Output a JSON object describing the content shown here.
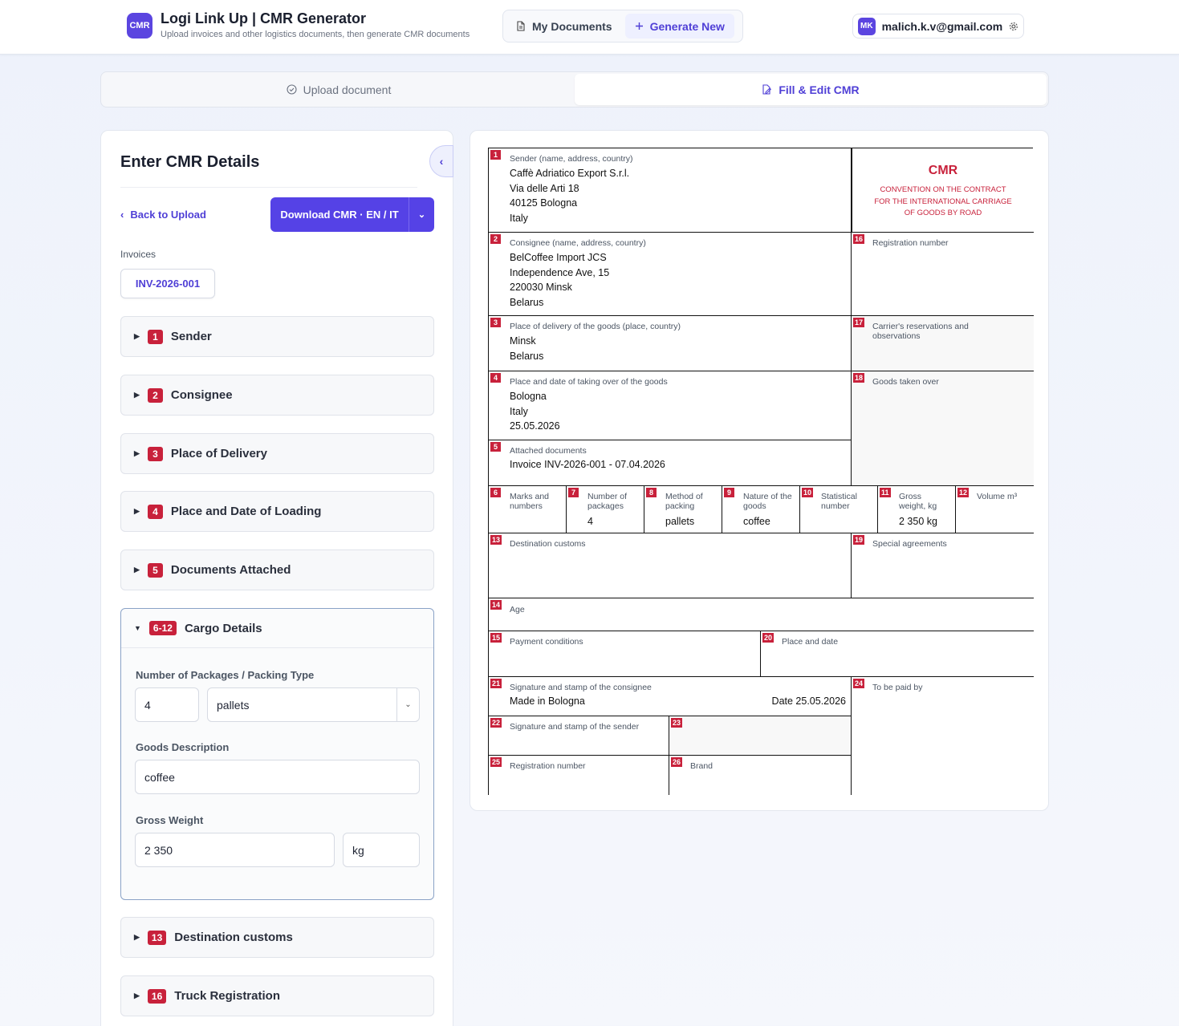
{
  "header": {
    "logo": "CMR",
    "title": "Logi Link Up | CMR Generator",
    "subtitle": "Upload invoices and other logistics documents, then generate CMR documents",
    "nav": [
      {
        "label": "My Documents",
        "icon": "document-icon"
      },
      {
        "label": "Generate New",
        "icon": "plus-icon"
      }
    ],
    "user": {
      "initials": "MK",
      "email": "malich.k.v@gmail.com"
    }
  },
  "steps": [
    {
      "label": "Upload document"
    },
    {
      "label": "Fill & Edit CMR"
    }
  ],
  "panel": {
    "title": "Enter CMR Details",
    "back": "Back to Upload",
    "download": "Download CMR · EN / IT",
    "invoices_label": "Invoices",
    "invoice": "INV-2026-001",
    "sections": [
      {
        "num": "1",
        "label": "Sender"
      },
      {
        "num": "2",
        "label": "Consignee"
      },
      {
        "num": "3",
        "label": "Place of Delivery"
      },
      {
        "num": "4",
        "label": "Place and Date of Loading"
      },
      {
        "num": "5",
        "label": "Documents Attached"
      }
    ],
    "cargo": {
      "num": "6-12",
      "label": "Cargo Details",
      "packages_label": "Number of Packages / Packing Type",
      "packages": "4",
      "packing": "pallets",
      "goods_label": "Goods Description",
      "goods": "coffee",
      "weight_label": "Gross Weight",
      "weight": "2 350",
      "unit": "kg"
    },
    "sections_after": [
      {
        "num": "13",
        "label": "Destination customs"
      },
      {
        "num": "16",
        "label": "Truck Registration"
      }
    ]
  },
  "cmr": {
    "title": "CMR",
    "convention": [
      "CONVENTION ON THE CONTRACT",
      "FOR THE INTERNATIONAL CARRIAGE",
      "OF GOODS BY ROAD"
    ],
    "sender": {
      "label": "Sender (name, address, country)",
      "lines": [
        "Caffè Adriatico Export S.r.l.",
        "Via delle Arti 18",
        "40125 Bologna",
        "Italy"
      ]
    },
    "consignee": {
      "label": "Consignee (name, address, country)",
      "lines": [
        "BelCoffee Import JCS",
        "Independence Ave, 15",
        "220030 Minsk",
        "Belarus"
      ]
    },
    "delivery": {
      "label": "Place of delivery of the goods (place, country)",
      "lines": [
        "Minsk",
        "Belarus"
      ]
    },
    "taking": {
      "label": "Place and date of taking over of the goods",
      "lines": [
        "Bologna",
        "Italy",
        "25.05.2026"
      ]
    },
    "attached": {
      "label": "Attached documents",
      "value": "Invoice INV-2026-001 - 07.04.2026"
    },
    "reg16": "Registration number",
    "res17": "Carrier's reservations and observations",
    "goods18": "Goods taken over",
    "marks": "Marks and numbers",
    "npack": {
      "label": "Number of packages",
      "value": "4"
    },
    "method": {
      "label": "Method of packing",
      "value": "pallets"
    },
    "nature": {
      "label": "Nature of the goods",
      "value": "coffee"
    },
    "stat": "Statistical number",
    "gross": {
      "label": "Gross weight, kg",
      "value": "2 350 kg"
    },
    "volume": "Volume m³",
    "customs": "Destination customs",
    "special": "Special agreements",
    "age": "Age",
    "payment": "Payment conditions",
    "place_date": "Place and date",
    "sig21": {
      "label": "Signature and stamp of the consignee",
      "made": "Made in Bologna",
      "date": "Date 25.05.2026"
    },
    "paid24": "To be paid by",
    "sig22": "Signature and stamp of the sender",
    "reg25": "Registration number",
    "brand26": "Brand"
  }
}
